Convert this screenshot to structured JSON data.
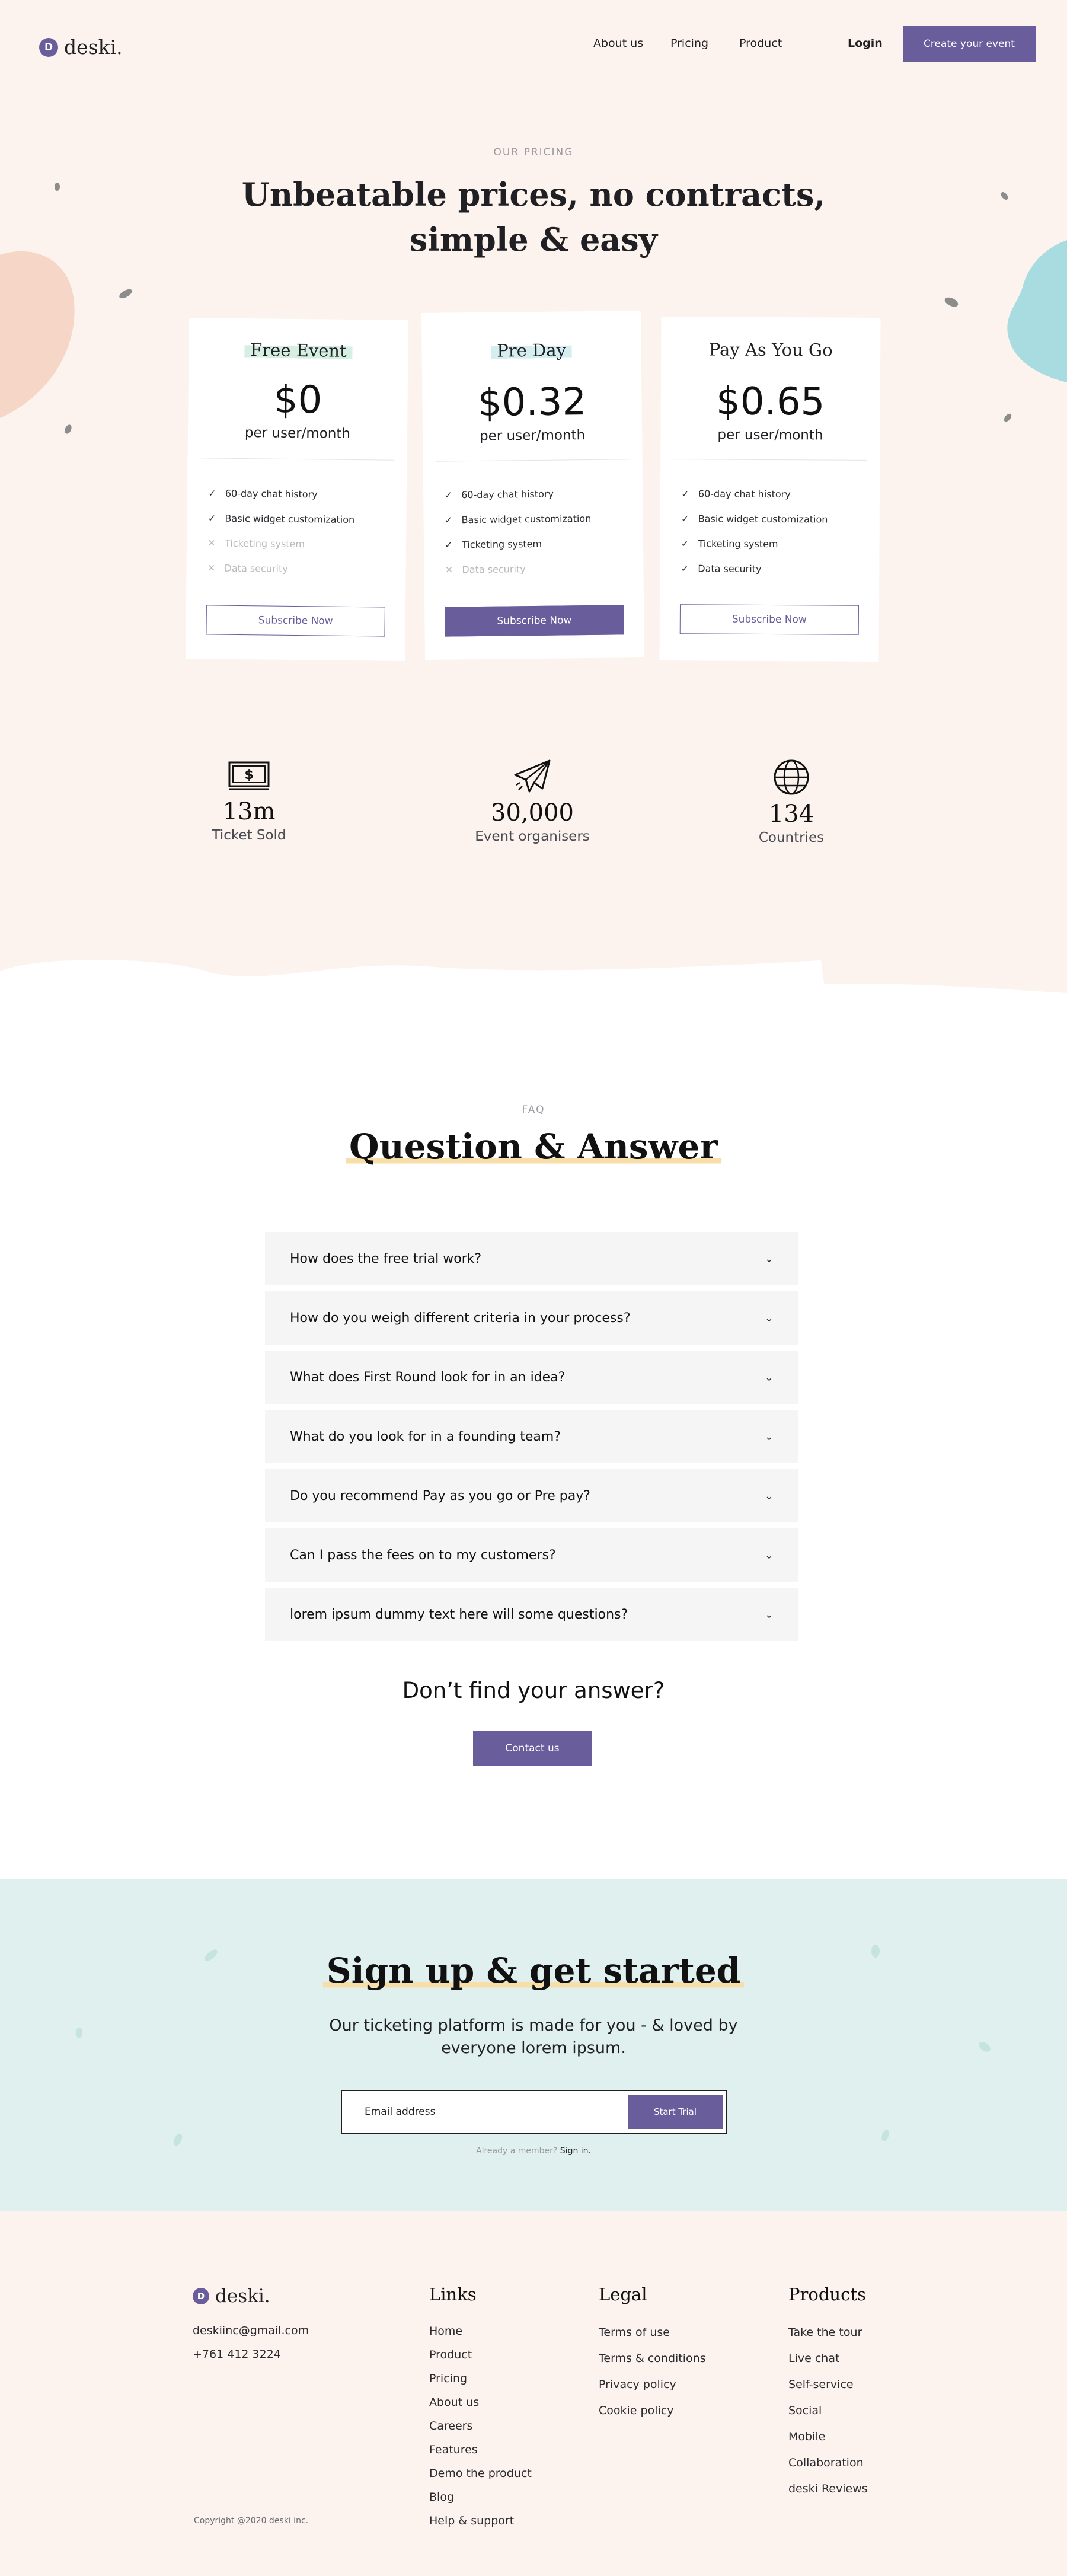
{
  "brand": {
    "mark": "D",
    "name": "deski.",
    "accent": "#6a5d9c"
  },
  "nav": {
    "items": [
      "About us",
      "Pricing",
      "Product"
    ],
    "login": "Login",
    "cta": "Create your event"
  },
  "pricing": {
    "eyebrow": "OUR PRICING",
    "title": "Unbeatable prices, no contracts, simple & easy",
    "plans": [
      {
        "name": "Free Event",
        "price": "$0",
        "per": "per user/month",
        "cta": "Subscribe Now",
        "features": [
          {
            "label": "60-day chat history",
            "included": true
          },
          {
            "label": "Basic widget customization",
            "included": true
          },
          {
            "label": "Ticketing system",
            "included": false
          },
          {
            "label": "Data security",
            "included": false
          }
        ]
      },
      {
        "name": "Pre Day",
        "price": "$0.32",
        "per": "per user/month",
        "cta": "Subscribe Now",
        "features": [
          {
            "label": "60-day chat history",
            "included": true
          },
          {
            "label": "Basic widget customization",
            "included": true
          },
          {
            "label": "Ticketing system",
            "included": true
          },
          {
            "label": "Data security",
            "included": false
          }
        ]
      },
      {
        "name": "Pay As You Go",
        "price": "$0.65",
        "per": "per user/month",
        "cta": "Subscribe Now",
        "features": [
          {
            "label": "60-day chat history",
            "included": true
          },
          {
            "label": "Basic widget customization",
            "included": true
          },
          {
            "label": "Ticketing system",
            "included": true
          },
          {
            "label": "Data security",
            "included": true
          }
        ]
      }
    ]
  },
  "stats": [
    {
      "icon": "money-icon",
      "value": "13m",
      "label": "Ticket Sold"
    },
    {
      "icon": "paper-plane-icon",
      "value": "30,000",
      "label": "Event organisers"
    },
    {
      "icon": "globe-icon",
      "value": "134",
      "label": "Countries"
    }
  ],
  "faq": {
    "eyebrow": "FAQ",
    "title": "Question & Answer",
    "questions": [
      "How does the free trial work?",
      "How do you weigh different criteria in your process?",
      "What does First Round look for in an idea?",
      "What do you look for in a founding team?",
      "Do you recommend Pay as you go or Pre pay?",
      "Can I pass the fees on to my customers?",
      "lorem ipsum dummy text here will some questions?"
    ],
    "no_answer": "Don’t find your answer?",
    "contact": "Contact us"
  },
  "signup": {
    "title": "Sign up & get started",
    "subtitle": "Our ticketing platform is made for you - & loved by everyone lorem ipsum.",
    "email_placeholder": "Email address",
    "button": "Start Trial",
    "already": "Already a member?",
    "sign_in": "Sign in."
  },
  "footer": {
    "email": "deskiinc@gmail.com",
    "phone": "+761 412 3224",
    "copyright": "Copyright @2020 deski inc.",
    "links": {
      "title": "Links",
      "items": [
        "Home",
        "Product",
        "Pricing",
        "About us",
        "Careers",
        "Features",
        "Demo the product",
        "Blog",
        "Help & support"
      ]
    },
    "legal": {
      "title": "Legal",
      "items": [
        "Terms of use",
        "Terms & conditions",
        "Privacy policy",
        "Cookie policy"
      ]
    },
    "products": {
      "title": "Products",
      "items": [
        "Take the tour",
        "Live chat",
        "Self-service",
        "Social",
        "Mobile",
        "Collaboration",
        "deski Reviews"
      ]
    }
  }
}
